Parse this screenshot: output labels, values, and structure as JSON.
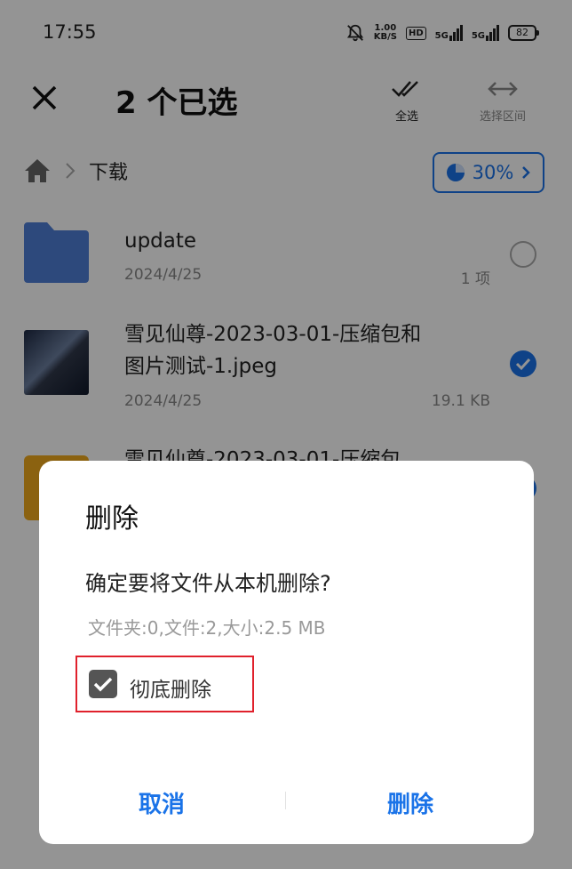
{
  "status_bar": {
    "time": "17:55",
    "speed_value": "1.00",
    "speed_unit": "KB/S",
    "hd": "HD",
    "sig1": "5G",
    "sig2": "5G",
    "battery": "82"
  },
  "top_bar": {
    "title": "2 个已选",
    "select_all": "全选",
    "select_range": "选择区间"
  },
  "breadcrumb": {
    "folder": "下载"
  },
  "storage": {
    "percent": "30%"
  },
  "files": [
    {
      "name": "update",
      "date": "2024/4/25",
      "meta": "1 项"
    },
    {
      "name_line1": "雪见仙尊-2023-03-01-压缩包和",
      "name_line2": "图片测试-1.jpeg",
      "date": "2024/4/25",
      "meta": "19.1 KB"
    },
    {
      "name": "雪见仙尊-2023-03-01-压缩包"
    }
  ],
  "dialog": {
    "title": "删除",
    "message": "确定要将文件从本机删除?",
    "info": "文件夹:0,文件:2,大小:2.5 MB",
    "checkbox_label": "彻底删除",
    "cancel": "取消",
    "confirm": "删除"
  },
  "colors": {
    "accent": "#1a73e8",
    "highlight": "#e0212c",
    "folder": "#4f7fd6"
  }
}
